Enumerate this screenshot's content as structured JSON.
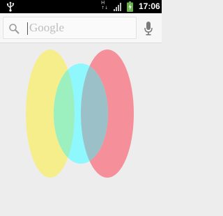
{
  "status_bar": {
    "time": "17:06",
    "network_type": "H",
    "icons": [
      "usb-icon",
      "signal-icon",
      "battery-charging-icon"
    ],
    "colors": {
      "background": "#000000",
      "battery": "#6ab04c"
    }
  },
  "search": {
    "placeholder": "Google",
    "value": "",
    "icons": [
      "search-icon",
      "mic-icon"
    ]
  },
  "canvas": {
    "background": "#ededed",
    "shapes": [
      {
        "name": "yellow-ellipse",
        "color": "#f6ee8a"
      },
      {
        "name": "cyan-ellipse",
        "color": "#8ff8ff"
      },
      {
        "name": "green-overlap",
        "color": "#9cf0c0"
      },
      {
        "name": "red-ellipse",
        "color": "#f5909a"
      },
      {
        "name": "blue-overlap",
        "color": "#9cc0c8"
      }
    ]
  }
}
